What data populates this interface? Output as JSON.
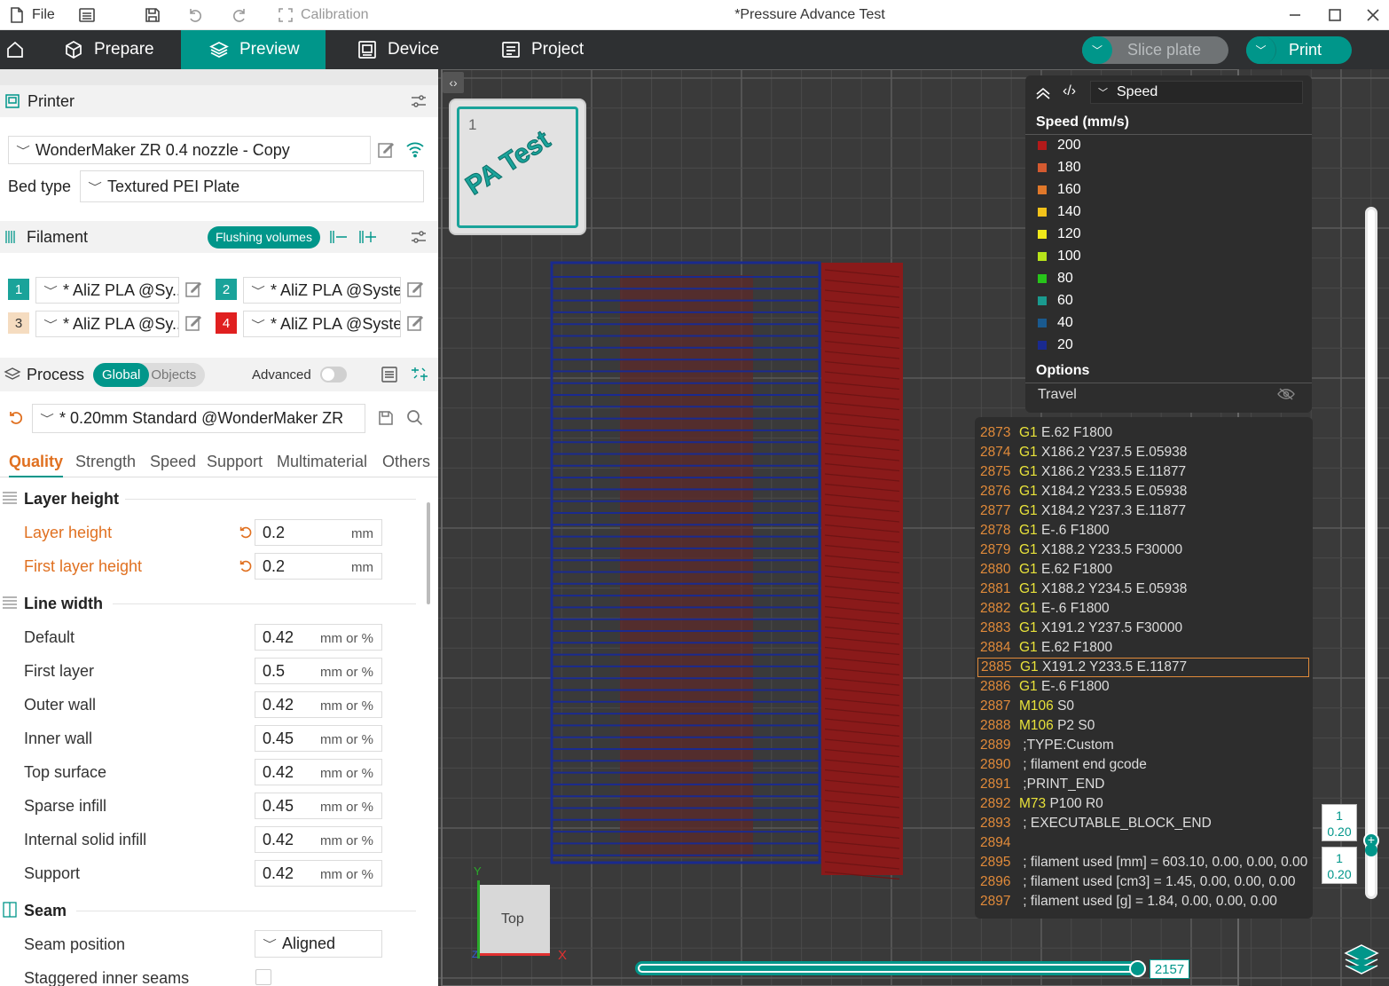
{
  "titlebar": {
    "file_label": "File",
    "calibration_label": "Calibration",
    "title": "*Pressure Advance Test"
  },
  "nav": {
    "prepare": "Prepare",
    "preview": "Preview",
    "device": "Device",
    "project": "Project",
    "slice_plate": "Slice plate",
    "print": "Print"
  },
  "printer": {
    "section_label": "Printer",
    "printer_name": "WonderMaker ZR 0.4 nozzle - Copy",
    "bed_type_label": "Bed type",
    "bed_type_value": "Textured PEI Plate"
  },
  "filament": {
    "section_label": "Filament",
    "flushing_label": "Flushing volumes",
    "slots": [
      {
        "num": "1",
        "name": "* AliZ PLA @Sy...",
        "color": "#1aa39a"
      },
      {
        "num": "2",
        "name": "* AliZ PLA @Syste...",
        "color": "#1aa39a"
      },
      {
        "num": "3",
        "name": "* AliZ PLA @Sy...",
        "color": "#f5dcc0"
      },
      {
        "num": "4",
        "name": "* AliZ PLA @Syste...",
        "color": "#e02020"
      }
    ]
  },
  "process": {
    "section_label": "Process",
    "global_label": "Global",
    "objects_label": "Objects",
    "advanced_label": "Advanced",
    "preset": "* 0.20mm Standard @WonderMaker ZR",
    "tabs": [
      "Quality",
      "Strength",
      "Speed",
      "Support",
      "Multimaterial",
      "Others"
    ]
  },
  "settings": {
    "layer_height_group": "Layer height",
    "layer_height_label": "Layer height",
    "layer_height_value": "0.2",
    "first_layer_height_label": "First layer height",
    "first_layer_height_value": "0.2",
    "unit_mm": "mm",
    "unit_mm_pct": "mm or %",
    "line_width_group": "Line width",
    "line_widths": [
      {
        "label": "Default",
        "value": "0.42"
      },
      {
        "label": "First layer",
        "value": "0.5"
      },
      {
        "label": "Outer wall",
        "value": "0.42"
      },
      {
        "label": "Inner wall",
        "value": "0.45"
      },
      {
        "label": "Top surface",
        "value": "0.42"
      },
      {
        "label": "Sparse infill",
        "value": "0.45"
      },
      {
        "label": "Internal solid infill",
        "value": "0.42"
      },
      {
        "label": "Support",
        "value": "0.42"
      }
    ],
    "seam_group": "Seam",
    "seam_position_label": "Seam position",
    "seam_position_value": "Aligned",
    "staggered_label": "Staggered inner seams"
  },
  "viewport": {
    "plate_number": "1",
    "plate_thumb_text": "PA Test",
    "view_cube_label": "Top",
    "axis_y": "Y",
    "axis_x": "X",
    "axis_z": "Z",
    "slider_value": "2157",
    "layer_top_num": "1",
    "layer_top_height": "0.20",
    "layer_bottom_num": "1",
    "layer_bottom_height": "0.20"
  },
  "legend": {
    "view_mode": "Speed",
    "title": "Speed (mm/s)",
    "items": [
      {
        "label": "200",
        "color": "#b31a1a"
      },
      {
        "label": "180",
        "color": "#d45a30"
      },
      {
        "label": "160",
        "color": "#e0782a"
      },
      {
        "label": "140",
        "color": "#f2c21a"
      },
      {
        "label": "120",
        "color": "#f0e81a"
      },
      {
        "label": "100",
        "color": "#b7e31a"
      },
      {
        "label": "80",
        "color": "#27c41a"
      },
      {
        "label": "60",
        "color": "#1a9a8f"
      },
      {
        "label": "40",
        "color": "#1a5a8f"
      },
      {
        "label": "20",
        "color": "#1a2a8f"
      }
    ],
    "options_label": "Options",
    "travel_label": "Travel"
  },
  "gcode": [
    {
      "n": "2873",
      "cmd": "G1",
      "rest": " E.62 F1800"
    },
    {
      "n": "2874",
      "cmd": "G1",
      "rest": " X186.2 Y237.5 E.05938"
    },
    {
      "n": "2875",
      "cmd": "G1",
      "rest": " X186.2 Y233.5 E.11877"
    },
    {
      "n": "2876",
      "cmd": "G1",
      "rest": " X184.2 Y233.5 E.05938"
    },
    {
      "n": "2877",
      "cmd": "G1",
      "rest": " X184.2 Y237.3 E.11877"
    },
    {
      "n": "2878",
      "cmd": "G1",
      "rest": " E-.6 F1800"
    },
    {
      "n": "2879",
      "cmd": "G1",
      "rest": " X188.2 Y233.5 F30000"
    },
    {
      "n": "2880",
      "cmd": "G1",
      "rest": " E.62 F1800"
    },
    {
      "n": "2881",
      "cmd": "G1",
      "rest": " X188.2 Y234.5 E.05938"
    },
    {
      "n": "2882",
      "cmd": "G1",
      "rest": " E-.6 F1800"
    },
    {
      "n": "2883",
      "cmd": "G1",
      "rest": " X191.2 Y237.5 F30000"
    },
    {
      "n": "2884",
      "cmd": "G1",
      "rest": " E.62 F1800"
    },
    {
      "n": "2885",
      "cmd": "G1",
      "rest": " X191.2 Y233.5 E.11877",
      "highlight": true
    },
    {
      "n": "2886",
      "cmd": "G1",
      "rest": " E-.6 F1800"
    },
    {
      "n": "2887",
      "cmd": "M106",
      "rest": " S0"
    },
    {
      "n": "2888",
      "cmd": "M106",
      "rest": " P2 S0"
    },
    {
      "n": "2889",
      "cmd": "",
      "rest": " ;TYPE:Custom"
    },
    {
      "n": "2890",
      "cmd": "",
      "rest": " ; filament end gcode"
    },
    {
      "n": "2891",
      "cmd": "",
      "rest": " ;PRINT_END"
    },
    {
      "n": "2892",
      "cmd": "M73",
      "rest": " P100 R0"
    },
    {
      "n": "2893",
      "cmd": "",
      "rest": " ; EXECUTABLE_BLOCK_END"
    },
    {
      "n": "2894",
      "cmd": "",
      "rest": ""
    },
    {
      "n": "2895",
      "cmd": "",
      "rest": " ; filament used [mm] = 603.10, 0.00, 0.00, 0.00"
    },
    {
      "n": "2896",
      "cmd": "",
      "rest": " ; filament used [cm3] = 1.45, 0.00, 0.00, 0.00"
    },
    {
      "n": "2897",
      "cmd": "",
      "rest": " ; filament used [g] = 1.84, 0.00, 0.00, 0.00"
    }
  ]
}
